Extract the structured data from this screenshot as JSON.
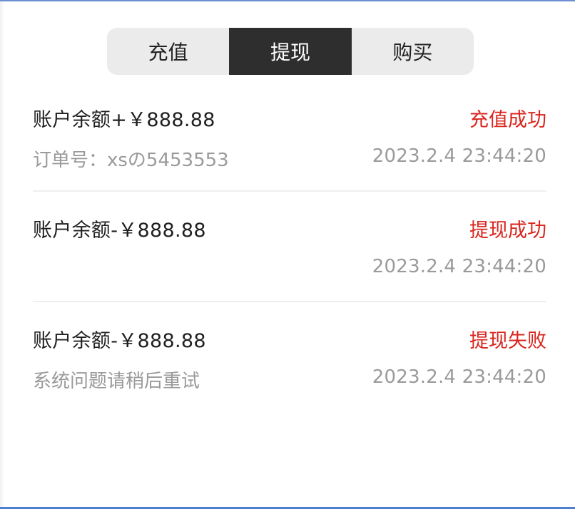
{
  "tabs": [
    {
      "label": "充值",
      "active": false
    },
    {
      "label": "提现",
      "active": true
    },
    {
      "label": "购买",
      "active": false
    }
  ],
  "records": [
    {
      "amount": "账户余额+￥888.88",
      "status": "充值成功",
      "sub": "订单号：xsの5453553",
      "time": "2023.2.4 23:44:20"
    },
    {
      "amount": "账户余额-￥888.88",
      "status": "提现成功",
      "sub": "",
      "time": "2023.2.4 23:44:20"
    },
    {
      "amount": "账户余额-￥888.88",
      "status": "提现失败",
      "sub": "系统问题请稍后重试",
      "time": "2023.2.4 23:44:20"
    }
  ],
  "colors": {
    "active_tab_bg": "#2e2e2e",
    "tab_bg": "#ebebeb",
    "status_red": "#d9251d",
    "muted_text": "#9a9a9a"
  }
}
